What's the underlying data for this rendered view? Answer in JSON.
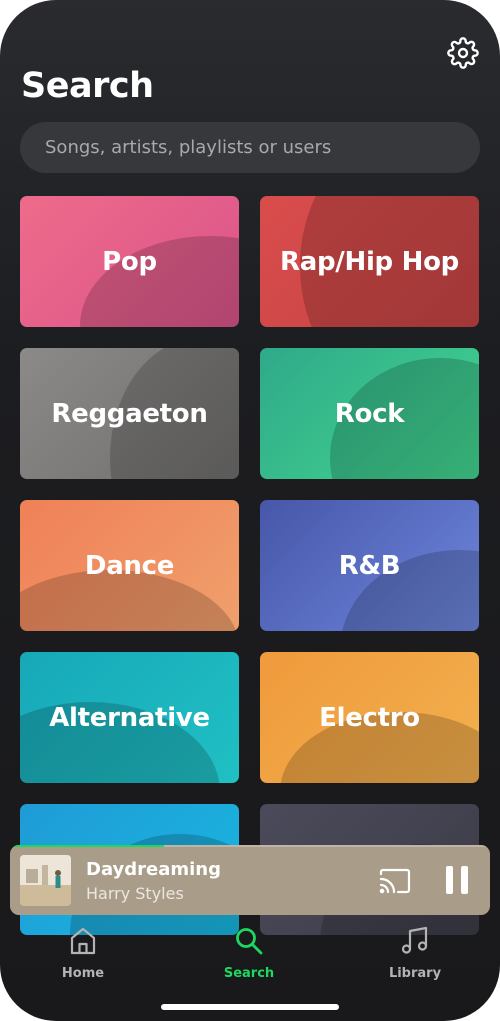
{
  "header": {
    "title": "Search",
    "settings_icon": "gear-icon"
  },
  "search": {
    "placeholder": "Songs, artists, playlists or users",
    "value": ""
  },
  "genres": [
    {
      "label": "Pop",
      "color_start": "#ef6b8a",
      "color_end": "#d9548a"
    },
    {
      "label": "Rap/Hip Hop",
      "color_start": "#d94c4c",
      "color_end": "#c64444"
    },
    {
      "label": "Reggaeton",
      "color_start": "#8c8a88",
      "color_end": "#6f6e6d"
    },
    {
      "label": "Rock",
      "color_start": "#2fa98a",
      "color_end": "#43d68f"
    },
    {
      "label": "Dance",
      "color_start": "#f08058",
      "color_end": "#f0a06c"
    },
    {
      "label": "R&B",
      "color_start": "#4756a8",
      "color_end": "#6d87dd"
    },
    {
      "label": "Alternative",
      "color_start": "#17a8b8",
      "color_end": "#20c0c4"
    },
    {
      "label": "Electro",
      "color_start": "#f09a3c",
      "color_end": "#f2b04e"
    },
    {
      "label": "",
      "color_start": "#1f9bd6",
      "color_end": "#19b7e0"
    },
    {
      "label": "",
      "color_start": "#4a4a5a",
      "color_end": "#3c3c48"
    }
  ],
  "now_playing": {
    "title": "Daydreaming",
    "artist": "Harry Styles",
    "progress": 0.32,
    "cast_icon": "cast-icon",
    "pause_icon": "pause-icon",
    "background": "#a99d8a"
  },
  "tabs": [
    {
      "label": "Home",
      "icon": "home-icon",
      "active": false
    },
    {
      "label": "Search",
      "icon": "search-icon",
      "active": true
    },
    {
      "label": "Library",
      "icon": "music-note-icon",
      "active": false
    }
  ],
  "colors": {
    "accent": "#1ed760",
    "background": "#1c1d20"
  }
}
